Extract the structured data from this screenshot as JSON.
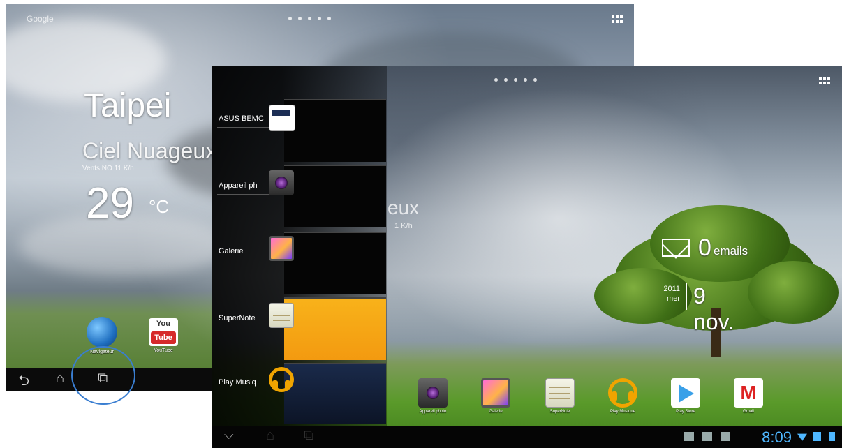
{
  "back_screen": {
    "top_label": "Google",
    "weather": {
      "city": "Taipei",
      "condition": "Ciel Nuageux",
      "winds": "Vents NO 11 K/h",
      "temperature": "29",
      "unit": "°C"
    },
    "apps": [
      {
        "label": "Navigateur",
        "icon": "globe-icon"
      },
      {
        "label": "YouTube",
        "icon": "youtube-icon",
        "logo_top": "You",
        "logo_bottom": "Tube"
      }
    ],
    "navbar": {
      "back": "back-icon",
      "home": "home-icon",
      "recents": "recent-apps-icon"
    }
  },
  "front_screen": {
    "recent_apps": [
      {
        "label": "ASUS BEMC",
        "icon": "asus-icon"
      },
      {
        "label": "Appareil ph",
        "icon": "camera-icon"
      },
      {
        "label": "Galerie",
        "icon": "gallery-icon"
      },
      {
        "label": "SuperNote",
        "icon": "supernote-icon"
      },
      {
        "label": "Play Musiq",
        "icon": "play-music-icon"
      }
    ],
    "ghost_weather": {
      "condition": "eux",
      "winds": "1 K/h"
    },
    "mail_widget": {
      "count": "0",
      "label": "emails"
    },
    "date_widget": {
      "year": "2011",
      "weekday": "mer",
      "date": "9 nov."
    },
    "apps": [
      {
        "label": "Appareil photo",
        "icon": "camera-icon"
      },
      {
        "label": "Galerie",
        "icon": "gallery-icon"
      },
      {
        "label": "SuperNote",
        "icon": "supernote-icon"
      },
      {
        "label": "Play Musique",
        "icon": "play-music-icon"
      },
      {
        "label": "Play Store",
        "icon": "play-store-icon"
      },
      {
        "label": "Gmail",
        "icon": "gmail-icon"
      }
    ],
    "status_bar": {
      "time": "8:09"
    },
    "colors": {
      "highlight_circle": "#3a7ed1",
      "clock": "#4fb7ff"
    }
  }
}
